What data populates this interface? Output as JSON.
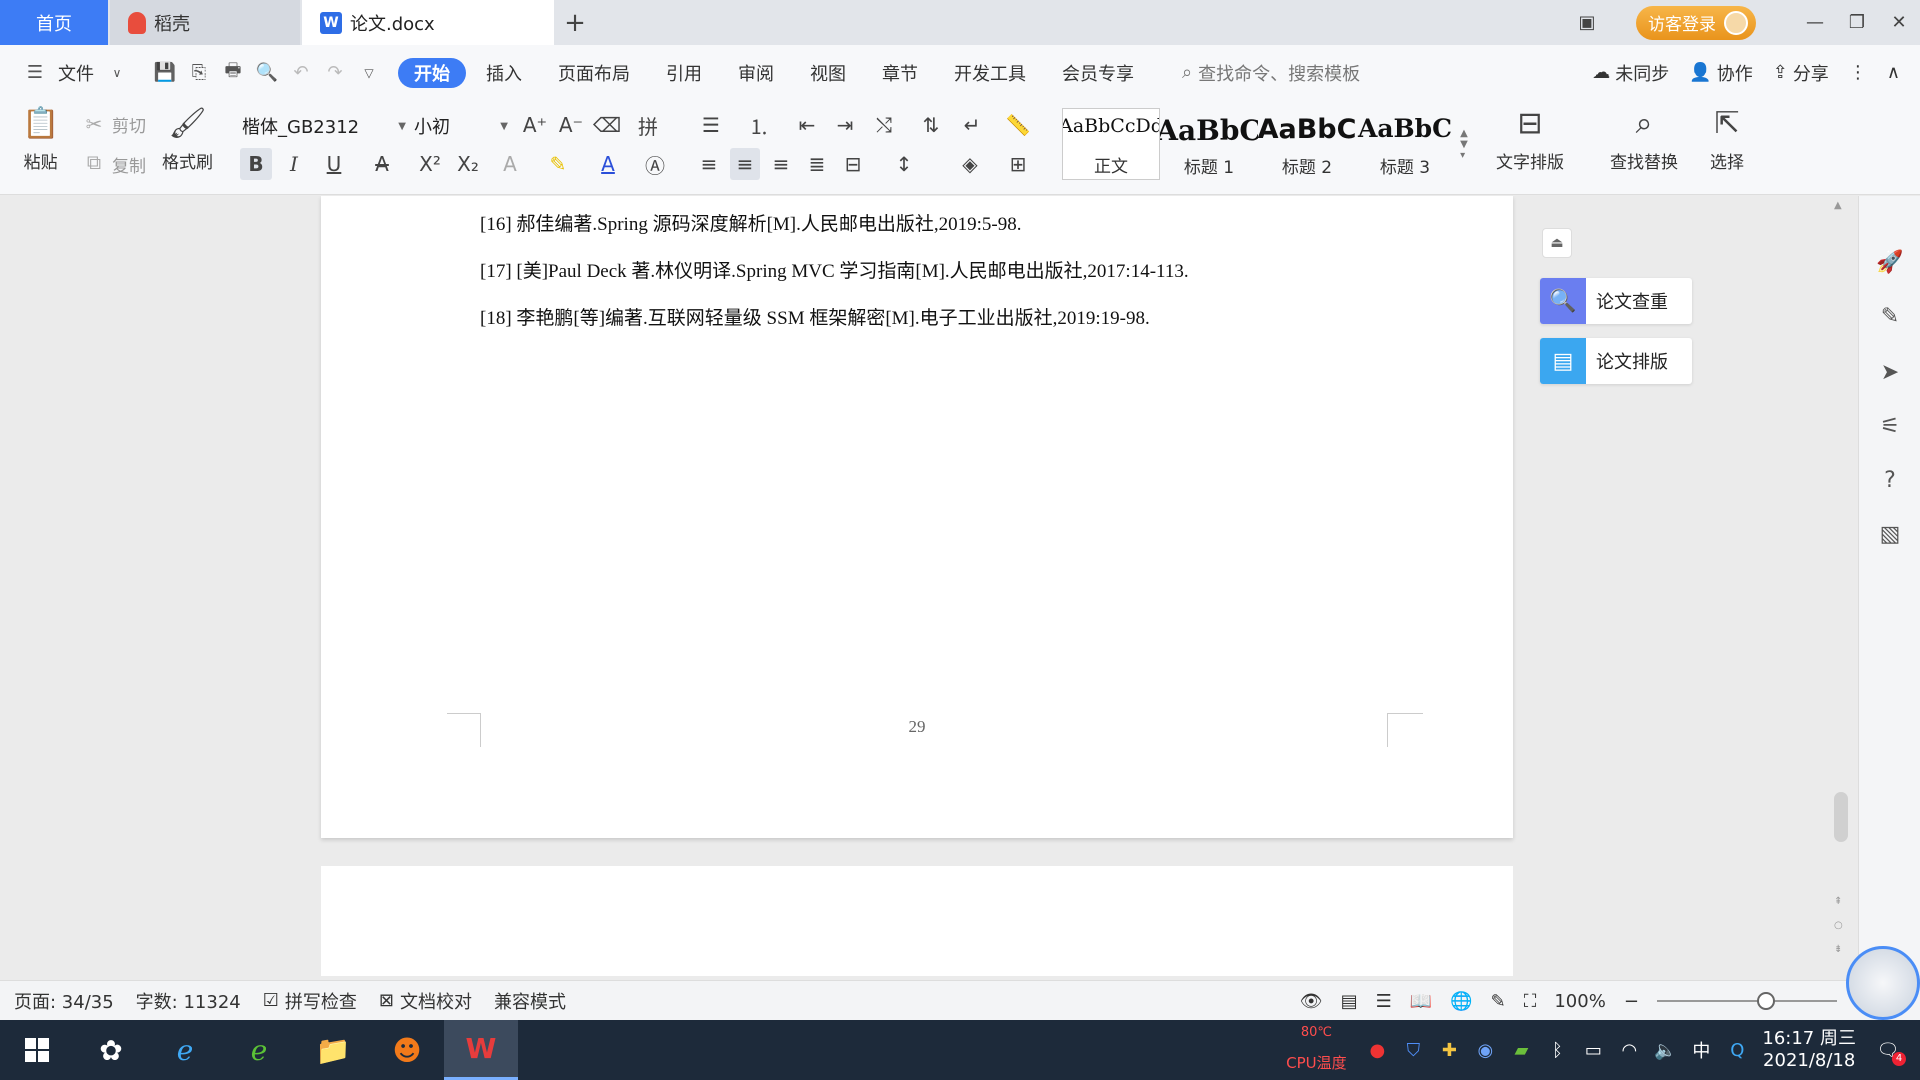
{
  "tabs": {
    "home": "首页",
    "daoke": "稻壳",
    "doc": "论文.docx",
    "add": "+"
  },
  "title_right": {
    "login": "访客登录"
  },
  "menu": {
    "file": "文件",
    "items": [
      "开始",
      "插入",
      "页面布局",
      "引用",
      "审阅",
      "视图",
      "章节",
      "开发工具",
      "会员专享"
    ],
    "search_placeholder": "查找命令、搜索模板",
    "sync": "未同步",
    "collab": "协作",
    "share": "分享"
  },
  "ribbon": {
    "paste": "粘贴",
    "cut": "剪切",
    "copy": "复制",
    "format_painter": "格式刷",
    "font_name": "楷体_GB2312",
    "font_size": "小初",
    "styles": [
      {
        "preview": "AaBbCcDd",
        "name": "正文"
      },
      {
        "preview": "AaBbC",
        "name": "标题 1"
      },
      {
        "preview": "AaBbC",
        "name": "标题 2"
      },
      {
        "preview": "AaBbC",
        "name": "标题 3"
      }
    ],
    "text_layout": "文字排版",
    "find_replace": "查找替换",
    "select": "选择"
  },
  "document": {
    "references": [
      "[16]  郝佳编著.Spring 源码深度解析[M].人民邮电出版社,2019:5-98.",
      "[17]  [美]Paul Deck  著.林仪明译.Spring MVC 学习指南[M].人民邮电出版社,2017:14-113.",
      "[18]  李艳鹏[等]编著.互联网轻量级 SSM 框架解密[M].电子工业出版社,2019:19-98."
    ],
    "page_number": "29"
  },
  "side_panel": {
    "check": "论文查重",
    "layout": "论文排版"
  },
  "status": {
    "page": "页面: 34/35",
    "words": "字数: 11324",
    "spell": "拼写检查",
    "proof": "文档校对",
    "compat": "兼容模式",
    "zoom": "100%"
  },
  "taskbar": {
    "cpu_value": "80℃",
    "cpu_label": "CPU温度",
    "ime": "中",
    "time": "16:17 周三",
    "date": "2021/8/18",
    "notif_count": "4"
  },
  "colors": {
    "accent": "#3d7cf5",
    "login": "#f0a030",
    "check_icon": "#6a7ef0",
    "layout_icon": "#3ba7f0",
    "taskbar": "#1d2a3a"
  }
}
